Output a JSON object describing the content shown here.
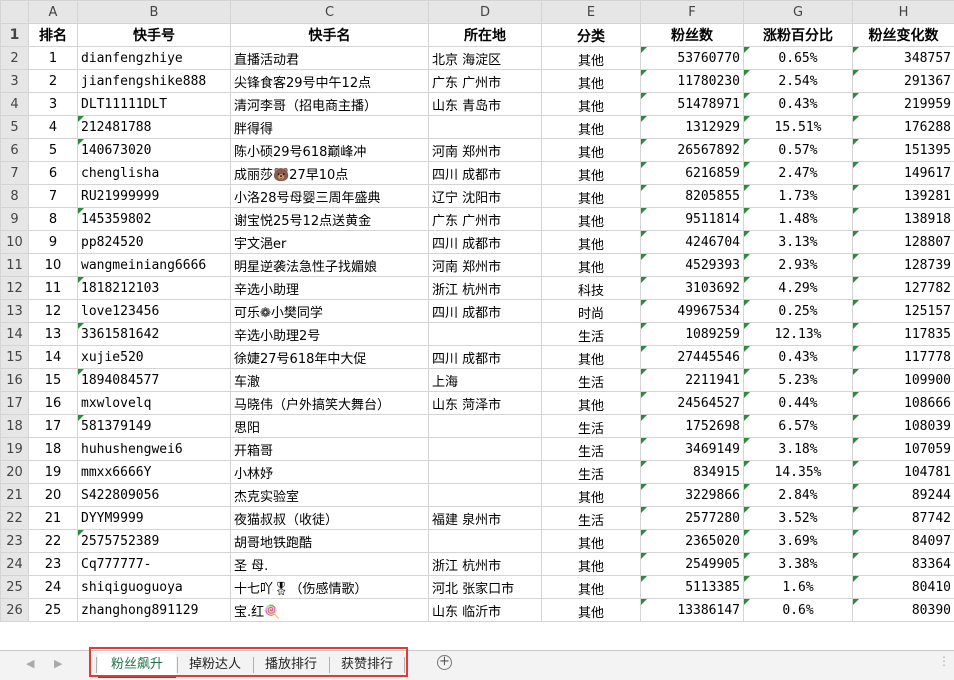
{
  "columns": [
    "A",
    "B",
    "C",
    "D",
    "E",
    "F",
    "G",
    "H"
  ],
  "header": [
    "排名",
    "快手号",
    "快手名",
    "所在地",
    "分类",
    "粉丝数",
    "涨粉百分比",
    "粉丝变化数"
  ],
  "rows": [
    [
      "1",
      "dianfengzhiye",
      "直播活动君",
      "北京 海淀区",
      "其他",
      "53760770",
      "0.65%",
      "348757"
    ],
    [
      "2",
      "jianfengshike888",
      "尖锋食客29号中午12点",
      "广东 广州市",
      "其他",
      "11780230",
      "2.54%",
      "291367"
    ],
    [
      "3",
      "DLT11111DLT",
      "清河李哥（招电商主播）",
      "山东 青岛市",
      "其他",
      "51478971",
      "0.43%",
      "219959"
    ],
    [
      "4",
      "212481788",
      "胖得得",
      "",
      "其他",
      "1312929",
      "15.51%",
      "176288"
    ],
    [
      "5",
      "140673020",
      "陈小硕29号618巅峰冲",
      "河南 郑州市",
      "其他",
      "26567892",
      "0.57%",
      "151395"
    ],
    [
      "6",
      "chenglisha",
      "成丽莎🐻27早10点",
      "四川 成都市",
      "其他",
      "6216859",
      "2.47%",
      "149617"
    ],
    [
      "7",
      "RU21999999",
      "小洛28号母婴三周年盛典",
      "辽宁 沈阳市",
      "其他",
      "8205855",
      "1.73%",
      "139281"
    ],
    [
      "8",
      "145359802",
      "谢宝悦25号12点送黄金",
      "广东 广州市",
      "其他",
      "9511814",
      "1.48%",
      "138918"
    ],
    [
      "9",
      "pp824520",
      "宇文浥er",
      "四川 成都市",
      "其他",
      "4246704",
      "3.13%",
      "128807"
    ],
    [
      "10",
      "wangmeiniang6666",
      "明星逆袭法急性子找媚娘",
      "河南 郑州市",
      "其他",
      "4529393",
      "2.93%",
      "128739"
    ],
    [
      "11",
      "1818212103",
      "辛选小助理",
      "浙江 杭州市",
      "科技",
      "3103692",
      "4.29%",
      "127782"
    ],
    [
      "12",
      "love123456",
      "可乐❁小樊同学",
      "四川 成都市",
      "时尚",
      "49967534",
      "0.25%",
      "125157"
    ],
    [
      "13",
      "3361581642",
      "辛选小助理2号",
      "",
      "生活",
      "1089259",
      "12.13%",
      "117835"
    ],
    [
      "14",
      "xujie520",
      "徐婕27号618年中大促",
      "四川 成都市",
      "其他",
      "27445546",
      "0.43%",
      "117778"
    ],
    [
      "15",
      "1894084577",
      "车澈",
      "上海",
      "生活",
      "2211941",
      "5.23%",
      "109900"
    ],
    [
      "16",
      "mxwlovelq",
      "马晓伟（户外搞笑大舞台）",
      "山东 菏泽市",
      "其他",
      "24564527",
      "0.44%",
      "108666"
    ],
    [
      "17",
      "581379149",
      "思阳",
      "",
      "生活",
      "1752698",
      "6.57%",
      "108039"
    ],
    [
      "18",
      "huhushengwei6",
      "开箱哥",
      "",
      "生活",
      "3469149",
      "3.18%",
      "107059"
    ],
    [
      "19",
      "mmxx6666Y",
      "小林妤",
      "",
      "生活",
      "834915",
      "14.35%",
      "104781"
    ],
    [
      "20",
      "S422809056",
      "杰克实验室",
      "",
      "其他",
      "3229866",
      "2.84%",
      "89244"
    ],
    [
      "21",
      "DYYM9999",
      "夜猫叔叔（收徒）",
      "福建 泉州市",
      "生活",
      "2577280",
      "3.52%",
      "87742"
    ],
    [
      "22",
      "2575752389",
      "胡哥地铁跑酷",
      "",
      "其他",
      "2365020",
      "3.69%",
      "84097"
    ],
    [
      "23",
      "Cq777777-",
      "圣    母.",
      "浙江 杭州市",
      "其他",
      "2549905",
      "3.38%",
      "83364"
    ],
    [
      "24",
      "shiqiguoguoya",
      "十七吖🎖（伤感情歌）",
      "河北 张家口市",
      "其他",
      "5113385",
      "1.6%",
      "80410"
    ],
    [
      "25",
      "zhanghong891129",
      "宝.红🍭",
      "山东 临沂市",
      "其他",
      "13386147",
      "0.6%",
      "80390"
    ]
  ],
  "sheet_tabs": [
    "粉丝飙升",
    "掉粉达人",
    "播放排行",
    "获赞排行"
  ],
  "active_tab": "粉丝飙升",
  "icons": {
    "add": "plus-circle-icon",
    "prev": "triangle-left-icon",
    "next": "triangle-right-icon",
    "more": "vertical-dots-icon"
  },
  "colors": {
    "active_tab": "#217346",
    "highlight_box": "#e53935",
    "comment_marker": "#2e8b3e"
  }
}
